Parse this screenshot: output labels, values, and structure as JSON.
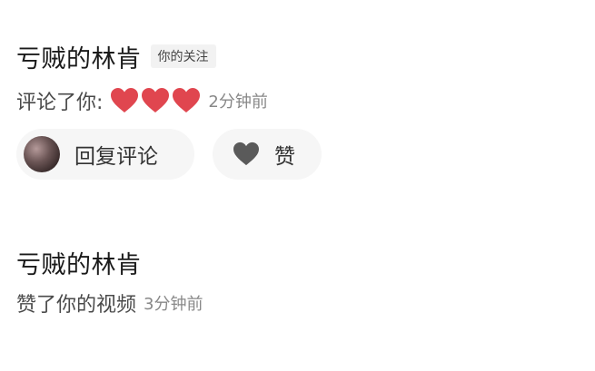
{
  "notifications": [
    {
      "username": "亏贼的林肯",
      "badge": "你的关注",
      "message": "评论了你:",
      "emoji": [
        "heart",
        "heart",
        "heart"
      ],
      "time": "2分钟前",
      "actions": {
        "reply_label": "回复评论",
        "like_label": "赞"
      }
    },
    {
      "username": "亏贼的林肯",
      "message": "赞了你的视频",
      "time": "3分钟前"
    }
  ],
  "colors": {
    "heart": "#e0464f",
    "like_icon": "#5a5a5a",
    "pill_bg": "#f6f6f6",
    "badge_bg": "#f2f2f2"
  },
  "icons": {
    "emoji": "red-heart-emoji",
    "like": "heart-icon",
    "avatar": "user-avatar"
  }
}
